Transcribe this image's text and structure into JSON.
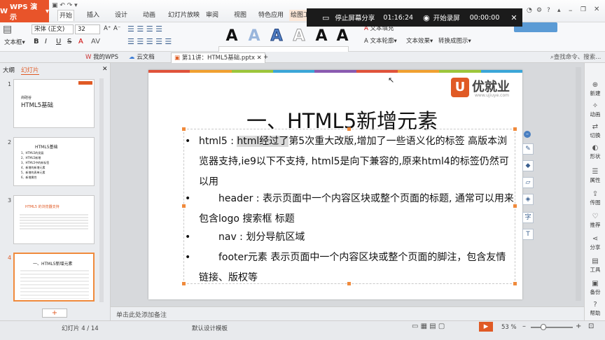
{
  "app": {
    "name": "WPS 演示",
    "logo_glyph": "W"
  },
  "menu": {
    "items": [
      {
        "label": "开始",
        "active": true
      },
      {
        "label": "插入"
      },
      {
        "label": "设计"
      },
      {
        "label": "动画"
      },
      {
        "label": "幻灯片放映"
      },
      {
        "label": "审阅"
      },
      {
        "label": "视图"
      },
      {
        "label": "特色应用"
      },
      {
        "label": "绘图工"
      }
    ]
  },
  "share_bar": {
    "stop_label": "停止屏幕分享",
    "elapsed": "01:16:24",
    "record_label": "开始录屏",
    "record_time": "00:00:00"
  },
  "ribbon": {
    "text_box_label": "文本框",
    "font_name": "宋体 (正文)",
    "font_size": "32",
    "font_grow": "A⁺",
    "font_shrink": "A⁻",
    "bold": "B",
    "italic": "I",
    "underline": "U",
    "strike": "S",
    "text_fill_label": "文本填充",
    "text_outline_label": "文本轮廓",
    "text_effect_label": "文本效果",
    "convert_smartart_label": "转换成图示",
    "style_glyph": "A"
  },
  "tabs": [
    {
      "label": "我的WPS",
      "icon": "wps-icon"
    },
    {
      "label": "云文档",
      "icon": "cloud-icon"
    },
    {
      "label": "第11讲：HTML5基础.pptx",
      "icon": "ppt-icon",
      "active": true
    },
    {
      "label": "+",
      "icon": "plus"
    }
  ],
  "search": {
    "placeholder": "查找命令、搜索..."
  },
  "left_panel": {
    "tab_outline": "大纲",
    "tab_slides": "幻灯片",
    "add_button": "+",
    "thumbs": [
      {
        "num": "1",
        "subtitle": "尚硅谷",
        "title": "HTML5基础"
      },
      {
        "num": "2",
        "title": "HTML5基础",
        "lines": [
          "1、HTML5的发展",
          "2、HTML5新增",
          "3、HTML5中的新标签",
          "4、新增的新增元素",
          "5、新增的表单元素",
          "6、新增属性"
        ]
      },
      {
        "num": "3",
        "title": "HTML5 的浏览器支持"
      },
      {
        "num": "4",
        "title": "一、HTML5新增元素"
      }
    ]
  },
  "slide": {
    "brand_name": "优就业",
    "brand_url": "www.ujiuye.com",
    "brand_color": "#e05a25",
    "title": "一、HTML5新增元素",
    "bullets": [
      {
        "bullet": "•",
        "lead": "html5 : ",
        "highlight": "html经过了",
        "rest": "第5次重大改版,增加了一些语义化的标签 高版本浏览器支持,ie9以下不支持, html5是向下兼容的,原来html4的标签仍然可以用"
      },
      {
        "bullet": "•",
        "lead": "　　header : ",
        "rest": "表示页面中一个内容区块或整个页面的标题, 通常可以用来包含logo 搜索框 标题"
      },
      {
        "bullet": "•",
        "lead": "　　nav : ",
        "rest": "划分导航区域"
      },
      {
        "bullet": "•",
        "lead": "　　footer元素 ",
        "rest": "表示页面中一个内容区块或整个页面的脚注，包含友情链接、版权等"
      }
    ],
    "stripe_colors": [
      "#e0523a",
      "#f0a030",
      "#9cc63a",
      "#3aa6d8",
      "#8a5ab0",
      "#e0523a",
      "#f0a030",
      "#9cc63a",
      "#3aa6d8"
    ]
  },
  "notes_placeholder": "单击此处添加备注",
  "right_sidebar": [
    {
      "label": "新建",
      "icon": "new-icon"
    },
    {
      "label": "动画",
      "icon": "animation-icon"
    },
    {
      "label": "切换",
      "icon": "transition-icon"
    },
    {
      "label": "形状",
      "icon": "shape-icon"
    },
    {
      "label": "属性",
      "icon": "property-icon"
    },
    {
      "label": "传图",
      "icon": "upload-icon"
    },
    {
      "label": "推荐",
      "icon": "recommend-icon"
    },
    {
      "label": "分享",
      "icon": "share-icon"
    },
    {
      "label": "工具",
      "icon": "tool-icon"
    },
    {
      "label": "备份",
      "icon": "backup-icon"
    },
    {
      "label": "帮助",
      "icon": "help-icon"
    }
  ],
  "status": {
    "slide_pos": "幻灯片 4 / 14",
    "template": "默认设计模板",
    "zoom": "53 %"
  }
}
